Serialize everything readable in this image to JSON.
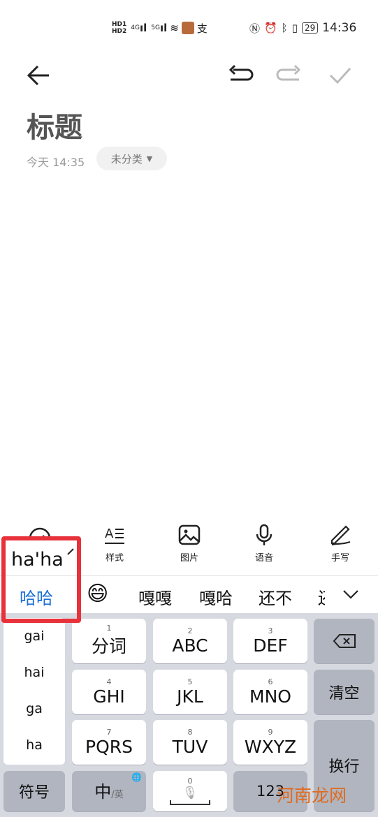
{
  "status_bar": {
    "left_icons": [
      "hd-sim1-icon",
      "hd-sim2-icon",
      "4g-signal-icon",
      "5g-signal-icon",
      "wifi-icon",
      "app-avatar-icon",
      "alipay-icon"
    ],
    "net1": "4G",
    "net2": "5G",
    "right_icons": [
      "nfc-icon",
      "alarm-icon",
      "bluetooth-icon",
      "vibrate-icon"
    ],
    "battery": "29",
    "time": "14:36"
  },
  "toolbar": {
    "back": "back-arrow-icon",
    "undo": "undo-icon",
    "redo": "redo-icon",
    "done": "check-icon"
  },
  "note": {
    "title": "标题",
    "date": "今天 14:35",
    "category": "未分类"
  },
  "edit_tools": [
    {
      "label": "样式",
      "icon": "text-style-icon"
    },
    {
      "label": "图片",
      "icon": "image-icon"
    },
    {
      "label": "语音",
      "icon": "mic-icon"
    },
    {
      "label": "手写",
      "icon": "pen-icon"
    }
  ],
  "ime": {
    "composition": "ha'ha",
    "candidates": [
      "哈哈",
      "😄",
      "嘎嘎",
      "嘎哈",
      "还不",
      "还"
    ],
    "pinyin_options": [
      "gai",
      "hai",
      "ga",
      "ha"
    ],
    "keys": [
      {
        "num": "1",
        "label": "分词"
      },
      {
        "num": "2",
        "label": "ABC"
      },
      {
        "num": "3",
        "label": "DEF"
      },
      {
        "num": "4",
        "label": "GHI"
      },
      {
        "num": "5",
        "label": "JKL"
      },
      {
        "num": "6",
        "label": "MNO"
      },
      {
        "num": "7",
        "label": "PQRS"
      },
      {
        "num": "8",
        "label": "TUV"
      },
      {
        "num": "9",
        "label": "WXYZ"
      }
    ],
    "clear": "清空",
    "enter": "换行",
    "symbol": "符号",
    "lang_main": "中",
    "lang_alt": "/英",
    "space_num": "0",
    "numbers": "123"
  },
  "watermark": "河南龙网",
  "colors": {
    "accent": "#1a6fd8",
    "highlight": "#e8313a",
    "keyboard_bg": "#d6d9df"
  }
}
